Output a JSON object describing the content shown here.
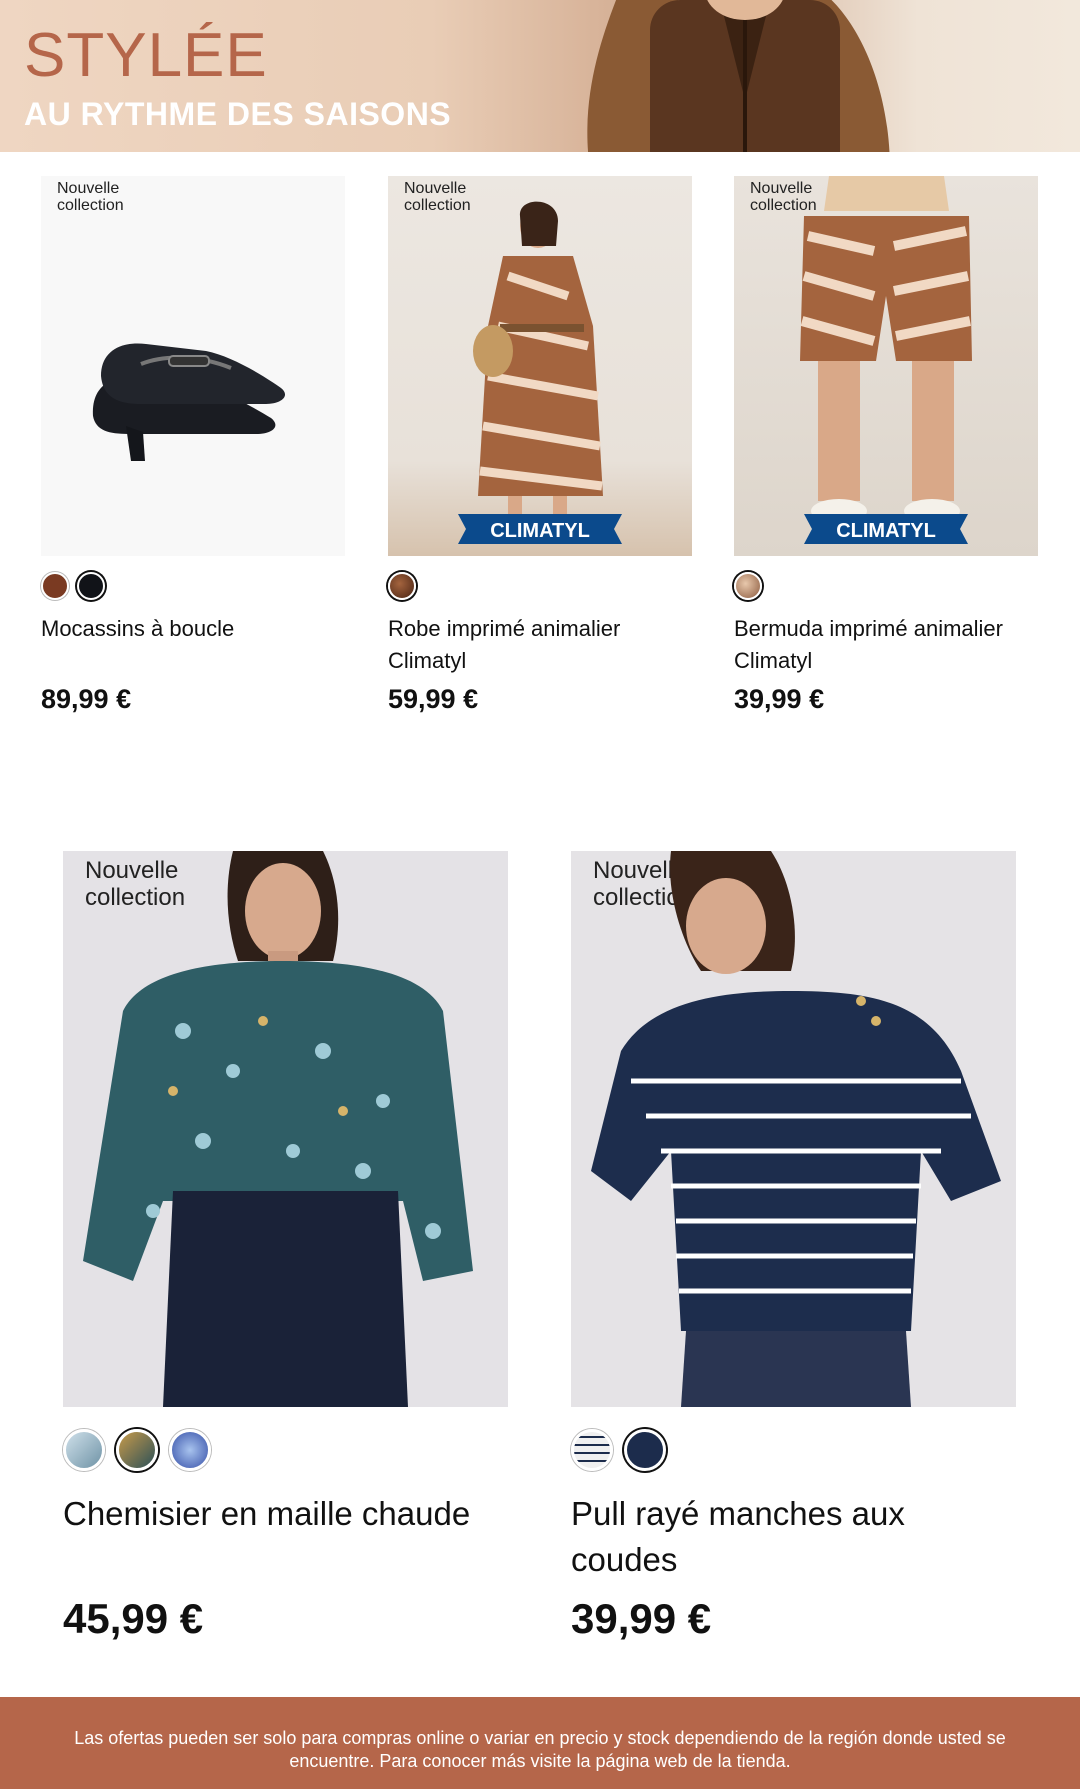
{
  "banner": {
    "brand": "STYLÉE",
    "tagline": "AU RYTHME DES SAISONS"
  },
  "badge_text": "Nouvelle\ncollection",
  "climatyl_label": "CLIMATYL",
  "products_row1": [
    {
      "name": "Mocassins à boucle",
      "price": "89,99 €",
      "swatches": [
        "#7a3a22",
        "#111318"
      ],
      "selected_swatch": 1
    },
    {
      "name": "Robe imprimé animalier Climatyl",
      "price": "59,99 €",
      "swatches": [
        "#6b3a22"
      ],
      "selected_swatch": 0
    },
    {
      "name": "Bermuda imprimé animalier Climatyl",
      "price": "39,99 €",
      "swatches": [
        "#8b5a3e"
      ],
      "selected_swatch": 0
    }
  ],
  "products_row2": [
    {
      "name": "Chemisier en maille chaude",
      "price": "45,99 €",
      "swatches": [
        "#9fb9c8",
        "#3d5e5a",
        "#4c6ec0"
      ],
      "selected_swatch": 1
    },
    {
      "name": "Pull rayé manches aux coudes",
      "price": "39,99 €",
      "swatches": [
        "#e6e6e6",
        "#1c2c4c"
      ],
      "selected_swatch": 1
    }
  ],
  "footer": {
    "disclaimer": "Las ofertas pueden ser solo para compras online o variar en precio y stock dependiendo de la región donde usted se encuentre. Para conocer más visite la página web de la tienda."
  },
  "colors": {
    "brand": "#b5664a",
    "climatyl_blue": "#0b4a8c"
  }
}
